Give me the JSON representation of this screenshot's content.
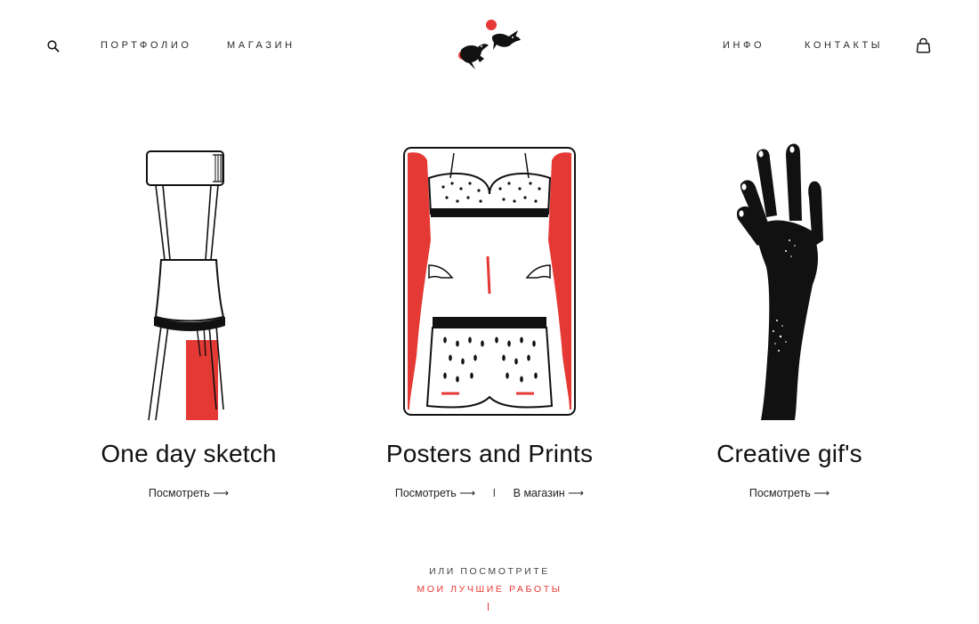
{
  "nav": {
    "left_items": [
      {
        "label": "ПОРТФОЛИО"
      },
      {
        "label": "МАГАЗИН"
      }
    ],
    "right_items": [
      {
        "label": "ИНФО"
      },
      {
        "label": "КОНТАКТЫ"
      }
    ]
  },
  "colors": {
    "accent": "#e53935",
    "ink": "#111111",
    "background": "#ffffff"
  },
  "cards": [
    {
      "title": "One day sketch",
      "links": [
        "Посмотреть ⟶"
      ]
    },
    {
      "title": "Posters and Prints",
      "links": [
        "Посмотреть ⟶",
        "В магазин ⟶"
      ],
      "separator": "I"
    },
    {
      "title": "Creative gif's",
      "links": [
        "Посмотреть ⟶"
      ]
    }
  ],
  "footer": {
    "or_text": "ИЛИ ПОСМОТРИТЕ",
    "best_link": "МОИ ЛУЧШИЕ РАБОТЫ"
  },
  "icons": {
    "search": "search-icon",
    "cart": "shopping-bag-icon",
    "logo": "birds-logo-icon"
  }
}
